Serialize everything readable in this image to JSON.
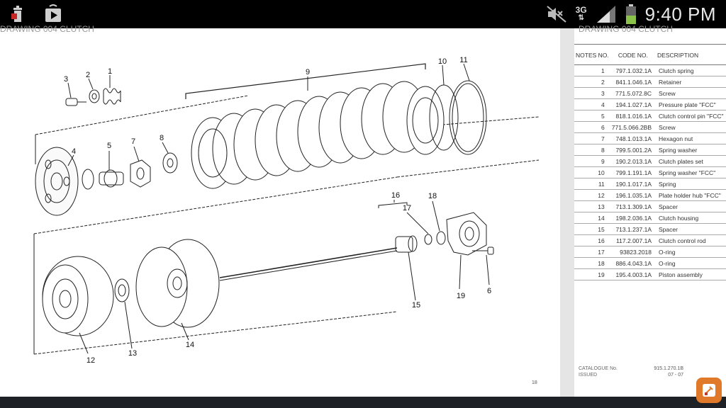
{
  "status_bar": {
    "network": "3G",
    "time": "9:40 PM"
  },
  "header": {
    "left_cut": "DRAWING 004   CLUTCH",
    "right_cut": "DRAWING 004   CLUTCH"
  },
  "table": {
    "headers": [
      "NOTES NO.",
      "CODE NO.",
      "DESCRIPTION"
    ],
    "rows": [
      {
        "no": "1",
        "code": "797.1.032.1A",
        "desc": "Clutch spring"
      },
      {
        "no": "2",
        "code": "841.1.046.1A",
        "desc": "Retainer"
      },
      {
        "no": "3",
        "code": "771.5.072.8C",
        "desc": "Screw"
      },
      {
        "no": "4",
        "code": "194.1.027.1A",
        "desc": "Pressure plate \"FCC\""
      },
      {
        "no": "5",
        "code": "818.1.016.1A",
        "desc": "Clutch control pin \"FCC\""
      },
      {
        "no": "6",
        "code": "771.5.066.2BB",
        "desc": "Screw"
      },
      {
        "no": "7",
        "code": "748.1.013.1A",
        "desc": "Hexagon nut"
      },
      {
        "no": "8",
        "code": "799.5.001.2A",
        "desc": "Spring washer"
      },
      {
        "no": "9",
        "code": "190.2.013.1A",
        "desc": "Clutch plates set"
      },
      {
        "no": "10",
        "code": "799.1.191.1A",
        "desc": "Spring washer \"FCC\""
      },
      {
        "no": "11",
        "code": "190.1.017.1A",
        "desc": "Spring"
      },
      {
        "no": "12",
        "code": "196.1.035.1A",
        "desc": "Plate holder hub \"FCC\""
      },
      {
        "no": "13",
        "code": "713.1.309.1A",
        "desc": "Spacer"
      },
      {
        "no": "14",
        "code": "198.2.036.1A",
        "desc": "Clutch housing"
      },
      {
        "no": "15",
        "code": "713.1.237.1A",
        "desc": "Spacer"
      },
      {
        "no": "16",
        "code": "117.2.007.1A",
        "desc": "Clutch control rod"
      },
      {
        "no": "17",
        "code": "93823.2018",
        "desc": "O-ring"
      },
      {
        "no": "18",
        "code": "886.4.043.1A",
        "desc": "O-ring"
      },
      {
        "no": "19",
        "code": "195.4.003.1A",
        "desc": "Piston assembly"
      }
    ]
  },
  "diagram_labels": [
    "1",
    "2",
    "3",
    "4",
    "5",
    "6",
    "7",
    "8",
    "9",
    "10",
    "11",
    "12",
    "13",
    "14",
    "15",
    "16",
    "17",
    "18",
    "19"
  ],
  "footer": {
    "catalogue_label": "CATALOGUE No.",
    "issued_label": "ISSUED",
    "catalogue_value": "915.1.270.1B",
    "issued_value": "07 - 07",
    "page_number": "18"
  },
  "icons": {
    "trash": "trash-icon",
    "play_store": "play-store-icon",
    "mute": "mute-icon",
    "signal": "signal-icon",
    "battery": "battery-icon",
    "float": "tools-icon"
  },
  "colors": {
    "status_bar": "#000000",
    "battery_green": "#8bc34a",
    "float_button": "#e07a2a"
  }
}
